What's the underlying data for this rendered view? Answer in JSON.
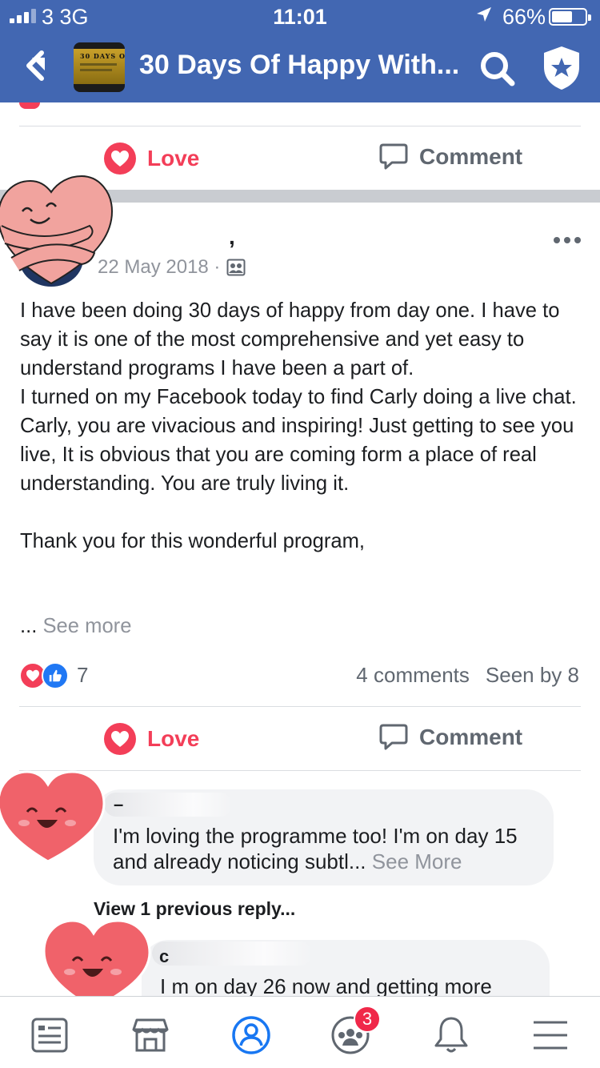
{
  "status_bar": {
    "carrier": "3  3G",
    "time": "11:01",
    "battery_percent": "66%",
    "battery_level": 0.66
  },
  "nav": {
    "title": "30 Days Of Happy With...",
    "group_thumb_text": "30 DAYS O"
  },
  "actions": {
    "love_label": "Love",
    "comment_label": "Comment"
  },
  "post": {
    "author_fragment": ",",
    "date": "22 May 2018 ·",
    "body": "I have been doing 30 days of happy from day one.  I have to say it is one of the most comprehensive and yet easy to understand programs I have been a part of.\nI turned on my Facebook today to find Carly doing a live chat.  Carly, you are vivacious and inspiring!  Just getting to see you live, It is obvious that you are coming form a place of real understanding.  You are truly living it.\n\nThank you for this wonderful program,",
    "ellipsis": "...",
    "see_more": "See more",
    "reaction_count": "7",
    "comments_count": "4 comments",
    "seen_by": "Seen by 8"
  },
  "comments": [
    {
      "name_fragment": "–",
      "text": "I'm loving the programme too! I'm on day 15 and already noticing subtl...",
      "see_more": "See More"
    },
    {
      "name_fragment": "c",
      "text": "I m on day 26 now and getting more"
    }
  ],
  "view_replies": "View 1 previous reply...",
  "tab_bar": {
    "items": [
      "news-feed",
      "marketplace",
      "profile",
      "groups",
      "notifications",
      "menu"
    ],
    "groups_badge": "3"
  },
  "colors": {
    "brand_blue": "#4267b2",
    "love_red": "#f33e58",
    "like_blue": "#2078f4",
    "muted_gray": "#90949c"
  }
}
